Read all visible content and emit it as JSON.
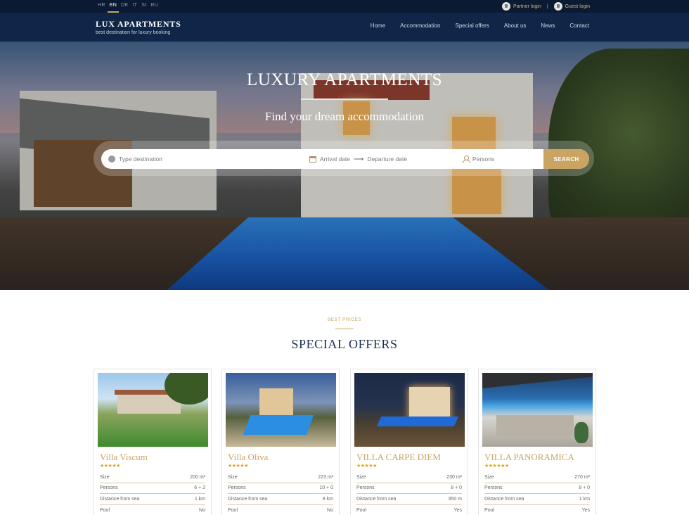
{
  "topbar": {
    "languages": [
      {
        "code": "HR",
        "active": false
      },
      {
        "code": "EN",
        "active": true
      },
      {
        "code": "DE",
        "active": false
      },
      {
        "code": "IT",
        "active": false
      },
      {
        "code": "SI",
        "active": false
      },
      {
        "code": "RU",
        "active": false
      }
    ],
    "partner_login": "Partner login",
    "separator": "|",
    "guest_login": "Guest login"
  },
  "header": {
    "brand_name": "LUX APARTMENTS",
    "brand_tagline": "best destination for luxury booking",
    "nav": [
      "Home",
      "Accommodation",
      "Special offers",
      "About us",
      "News",
      "Contact"
    ]
  },
  "hero": {
    "title": "LUXURY APARTMENTS",
    "subtitle": "Find your dream accommodation",
    "search": {
      "destination_placeholder": "Type destination",
      "arrival_placeholder": "Arrival date",
      "departure_placeholder": "Departure date",
      "persons_placeholder": "Persons",
      "button": "SEARCH"
    }
  },
  "offers": {
    "kicker": "BEST PRICES",
    "title": "SPECIAL OFFERS",
    "cards": [
      {
        "name": "Villa Viscum",
        "stars": "★★★★★",
        "rows": [
          {
            "label": "Size",
            "value": "200 m²"
          },
          {
            "label": "Persons",
            "value": "6 + 2"
          },
          {
            "label": "Distance from sea",
            "value": "1 km"
          },
          {
            "label": "Pool",
            "value": "No"
          }
        ]
      },
      {
        "name": "Villa Oliva",
        "stars": "★★★★★",
        "rows": [
          {
            "label": "Size",
            "value": "223 m²"
          },
          {
            "label": "Persons",
            "value": "10 + 0"
          },
          {
            "label": "Distance from sea",
            "value": "8 km"
          },
          {
            "label": "Pool",
            "value": "No"
          }
        ]
      },
      {
        "name": "VILLA CARPE DIEM",
        "stars": "★★★★★",
        "rows": [
          {
            "label": "Size",
            "value": "230 m²"
          },
          {
            "label": "Persons",
            "value": "8 + 0"
          },
          {
            "label": "Distance from sea",
            "value": "350 m"
          },
          {
            "label": "Pool",
            "value": "Yes"
          }
        ]
      },
      {
        "name": "VILLA PANORAMICA",
        "stars": "★★★★★★",
        "rows": [
          {
            "label": "Size",
            "value": "270 m²"
          },
          {
            "label": "Persons",
            "value": "8 + 0"
          },
          {
            "label": "Distance from sea",
            "value": "1 km"
          },
          {
            "label": "Pool",
            "value": "Yes"
          }
        ]
      }
    ]
  },
  "colors": {
    "topbar": "#0b1a33",
    "header": "#0f2648",
    "accent_gold": "#c9a462",
    "title_navy": "#1c3050"
  }
}
